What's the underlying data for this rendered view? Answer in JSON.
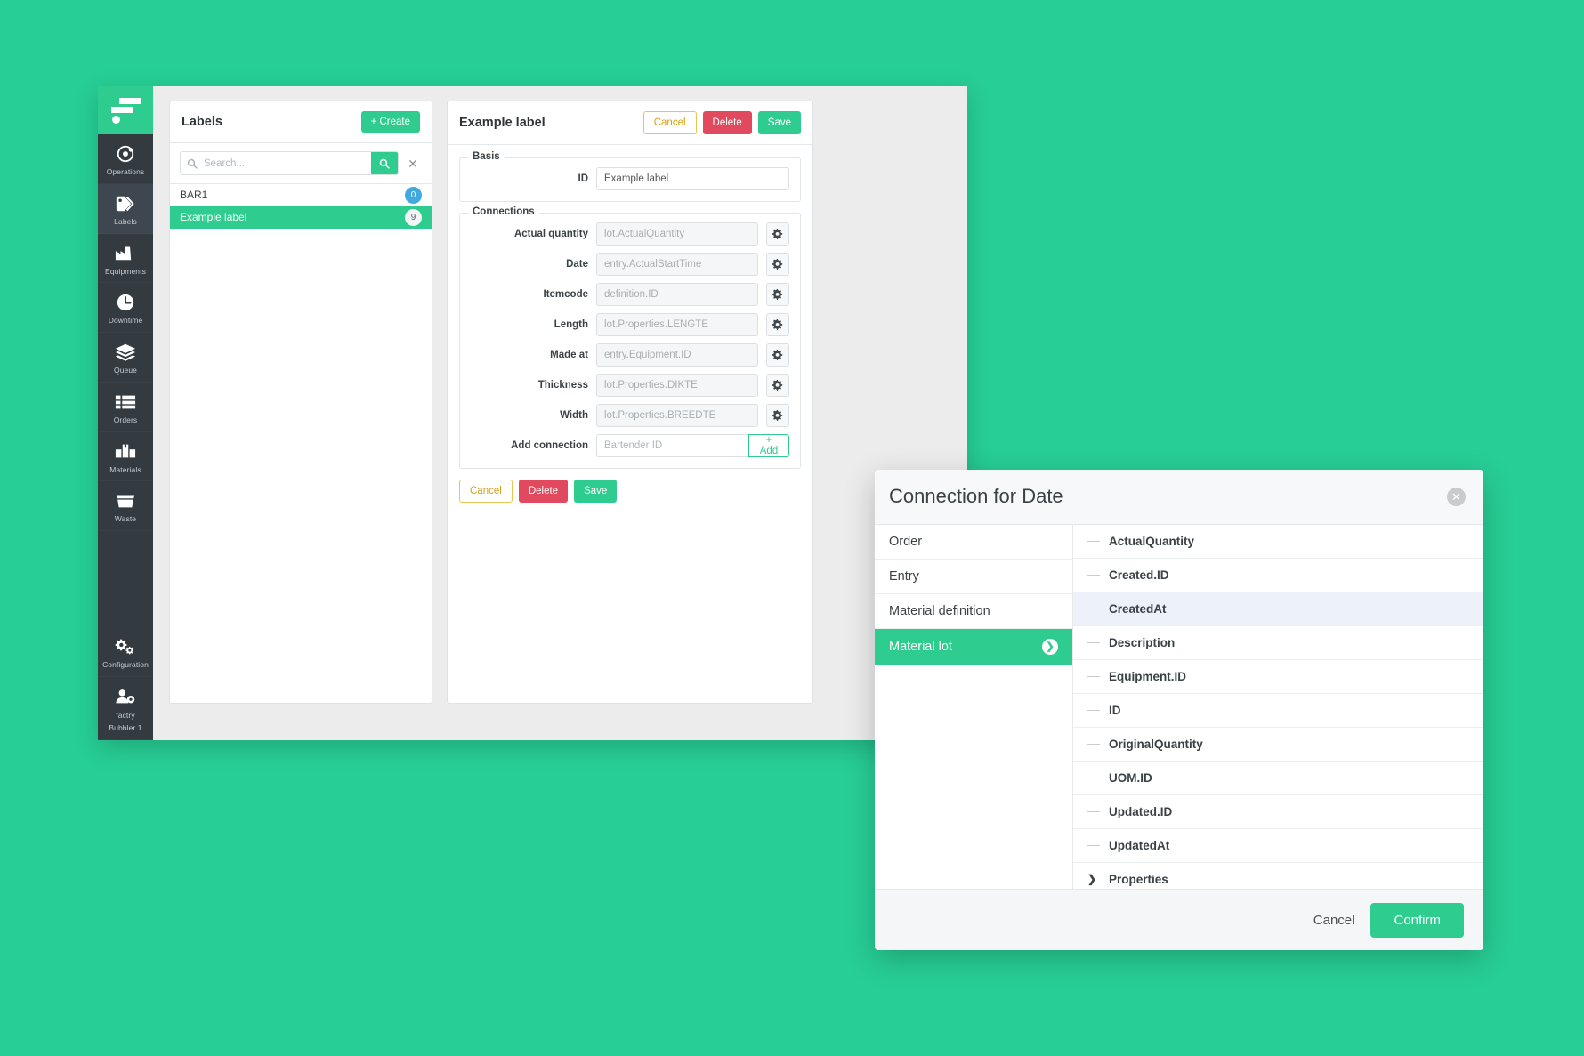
{
  "theme": {
    "background": "#27ce95",
    "accent_green": "#2ecc8f",
    "danger_red": "#e14a5e",
    "warning_yellow": "#f0c252",
    "badge_blue": "#3fa9e0",
    "highlight_row": "#edf1fa",
    "sidebar_dark": "#333b41",
    "sidebar_selected": "#3e4750"
  },
  "sidebar": {
    "logo_name": "app-logo",
    "items": [
      {
        "label": "Operations",
        "icon": "operations-icon",
        "selected": false
      },
      {
        "label": "Labels",
        "icon": "tag-icon",
        "selected": true
      },
      {
        "label": "Equipments",
        "icon": "factory-icon",
        "selected": false
      },
      {
        "label": "Downtime",
        "icon": "clock-icon",
        "selected": false
      },
      {
        "label": "Queue",
        "icon": "layers-icon",
        "selected": false
      },
      {
        "label": "Orders",
        "icon": "list-icon",
        "selected": false
      },
      {
        "label": "Materials",
        "icon": "boxes-icon",
        "selected": false
      },
      {
        "label": "Waste",
        "icon": "trash-icon",
        "selected": false
      }
    ],
    "bottom_items": [
      {
        "label": "Configuration",
        "icon": "gears-icon"
      },
      {
        "label": "factry\nBubbler 1",
        "label_line1": "factry",
        "label_line2": "Bubbler 1",
        "icon": "user-gear-icon"
      }
    ]
  },
  "labels_panel": {
    "title": "Labels",
    "create_button": "+ Create",
    "search": {
      "value": "",
      "placeholder": "Search...",
      "search_icon": "search-icon",
      "clear_icon": "close-icon"
    },
    "rows": [
      {
        "name": "BAR1",
        "count": "0",
        "badge_style": "blue",
        "active": false
      },
      {
        "name": "Example label",
        "count": "9",
        "badge_style": "grey",
        "active": true
      }
    ]
  },
  "detail_panel": {
    "title": "Example label",
    "toolbar": {
      "cancel": "Cancel",
      "delete": "Delete",
      "save": "Save"
    },
    "basis": {
      "legend": "Basis",
      "id_label": "ID",
      "id_value": "Example label"
    },
    "connections": {
      "legend": "Connections",
      "rows": [
        {
          "label": "Actual quantity",
          "value": "lot.ActualQuantity",
          "gear": "gear-icon"
        },
        {
          "label": "Date",
          "value": "entry.ActualStartTime",
          "gear": "gear-icon"
        },
        {
          "label": "Itemcode",
          "value": "definition.ID",
          "gear": "gear-icon"
        },
        {
          "label": "Length",
          "value": "lot.Properties.LENGTE",
          "gear": "gear-icon"
        },
        {
          "label": "Made at",
          "value": "entry.Equipment.ID",
          "gear": "gear-icon"
        },
        {
          "label": "Thickness",
          "value": "lot.Properties.DIKTE",
          "gear": "gear-icon"
        },
        {
          "label": "Width",
          "value": "lot.Properties.BREEDTE",
          "gear": "gear-icon"
        }
      ],
      "add_row": {
        "label": "Add connection",
        "placeholder": "Bartender ID",
        "value": "",
        "add_button": "+ Add"
      }
    },
    "footer": {
      "cancel": "Cancel",
      "delete": "Delete",
      "save": "Save"
    }
  },
  "modal": {
    "title": "Connection for Date",
    "close_icon": "close-icon",
    "sources": [
      {
        "label": "Order",
        "active": false
      },
      {
        "label": "Entry",
        "active": false
      },
      {
        "label": "Material definition",
        "active": false
      },
      {
        "label": "Material lot",
        "active": true
      }
    ],
    "properties": [
      {
        "label": "ActualQuantity",
        "expandable": false,
        "highlighted": false
      },
      {
        "label": "Created.ID",
        "expandable": false,
        "highlighted": false
      },
      {
        "label": "CreatedAt",
        "expandable": false,
        "highlighted": true
      },
      {
        "label": "Description",
        "expandable": false,
        "highlighted": false
      },
      {
        "label": "Equipment.ID",
        "expandable": false,
        "highlighted": false
      },
      {
        "label": "ID",
        "expandable": false,
        "highlighted": false
      },
      {
        "label": "OriginalQuantity",
        "expandable": false,
        "highlighted": false
      },
      {
        "label": "UOM.ID",
        "expandable": false,
        "highlighted": false
      },
      {
        "label": "Updated.ID",
        "expandable": false,
        "highlighted": false
      },
      {
        "label": "UpdatedAt",
        "expandable": false,
        "highlighted": false
      },
      {
        "label": "Properties",
        "expandable": true,
        "highlighted": false
      }
    ],
    "footer": {
      "cancel": "Cancel",
      "confirm": "Confirm"
    }
  }
}
